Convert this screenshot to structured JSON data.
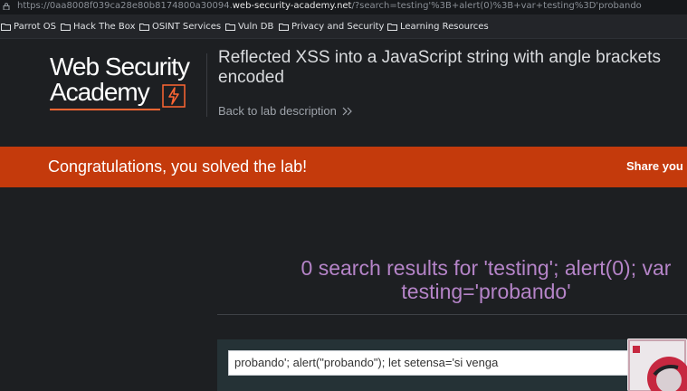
{
  "browser": {
    "url_prefix": "https://0aa8008f039ca28e80b8174800a30094.",
    "url_host": "web-security-academy.net",
    "url_path": "/?search=testing'%3B+alert(0)%3B+var+testing%3D'probando"
  },
  "bookmarks": [
    {
      "label": "Parrot OS"
    },
    {
      "label": "Hack The Box"
    },
    {
      "label": "OSINT Services"
    },
    {
      "label": "Vuln DB"
    },
    {
      "label": "Privacy and Security"
    },
    {
      "label": "Learning Resources"
    }
  ],
  "header": {
    "logo_line1": "Web Security",
    "logo_line2": "Academy",
    "lab_title_line1": "Reflected XSS into a JavaScript string with angle brackets",
    "lab_title_line2": "encoded",
    "back_link": "Back to lab description"
  },
  "banner": {
    "message": "Congratulations, you solved the lab!",
    "share": "Share you"
  },
  "main": {
    "results_line1": "0 search results for 'testing'; alert(0); var",
    "results_line2": "testing='probando'",
    "search_value": "probando'; alert(\"probando\"); let setensa='si venga"
  },
  "colors": {
    "banner": "#c43a0c",
    "heading": "#b584c8",
    "logo_accent": "#ff6633"
  }
}
